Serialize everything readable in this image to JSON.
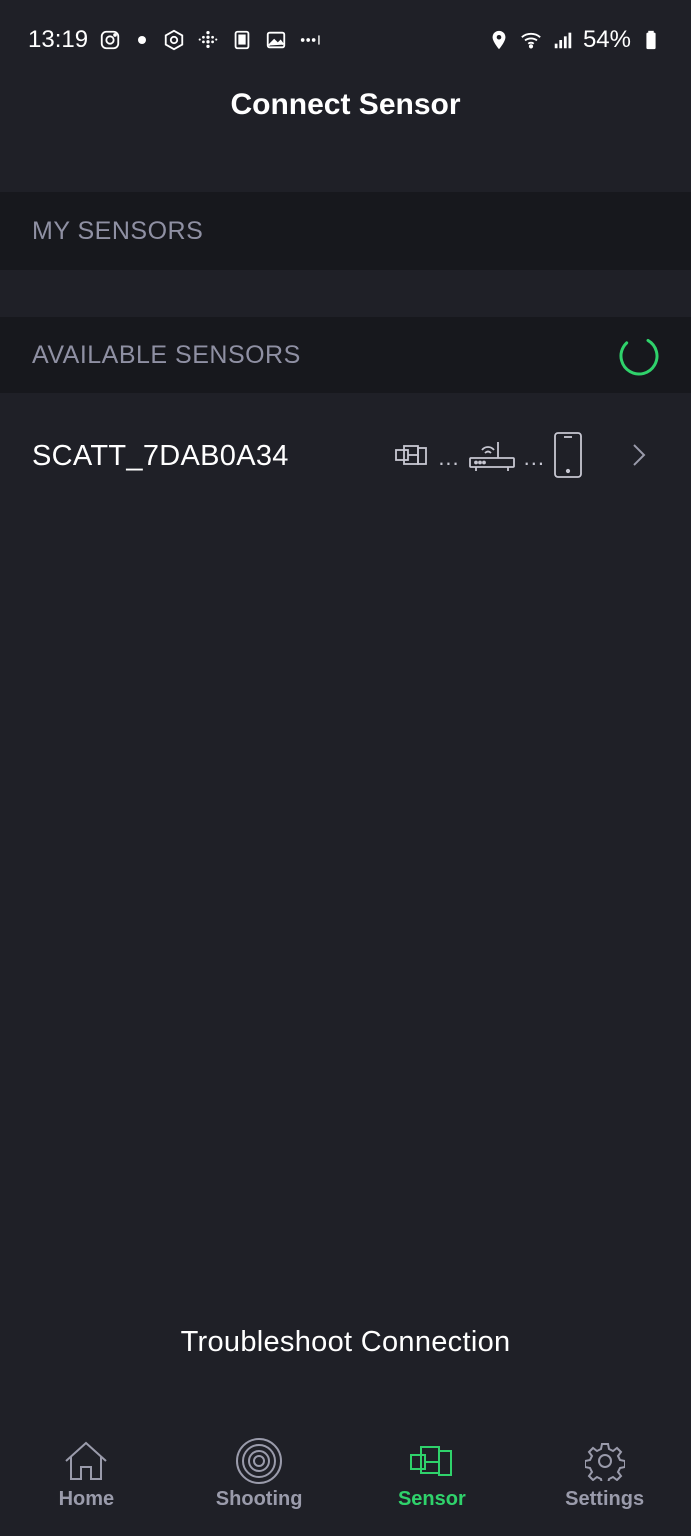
{
  "status_bar": {
    "time": "13:19",
    "battery": "54%"
  },
  "header": {
    "title": "Connect Sensor"
  },
  "sections": {
    "my_sensors": "MY SENSORS",
    "available_sensors": "AVAILABLE SENSORS"
  },
  "sensors": [
    {
      "name": "SCATT_7DAB0A34",
      "chain_dots": "..."
    }
  ],
  "troubleshoot_label": "Troubleshoot Connection",
  "nav": {
    "home": "Home",
    "shooting": "Shooting",
    "sensor": "Sensor",
    "settings": "Settings"
  },
  "colors": {
    "background": "#1f2027",
    "section_band": "#17181d",
    "accent": "#2fd26b",
    "muted_text": "#8f90a3",
    "nav_inactive": "#9a9bab"
  },
  "icons": {
    "status_left": [
      "instagram-icon",
      "dot-icon",
      "hex-app-icon",
      "grid-app-icon",
      "square-app-icon",
      "image-icon",
      "more-dots-icon"
    ],
    "status_right": [
      "location-icon",
      "wifi-icon",
      "signal-icon",
      "battery-icon"
    ],
    "connection_chain": [
      "sensor-icon",
      "router-icon",
      "phone-icon"
    ],
    "row_action": "chevron-right-icon",
    "nav": [
      "home-icon",
      "target-icon",
      "sensor-icon",
      "gear-icon"
    ]
  }
}
